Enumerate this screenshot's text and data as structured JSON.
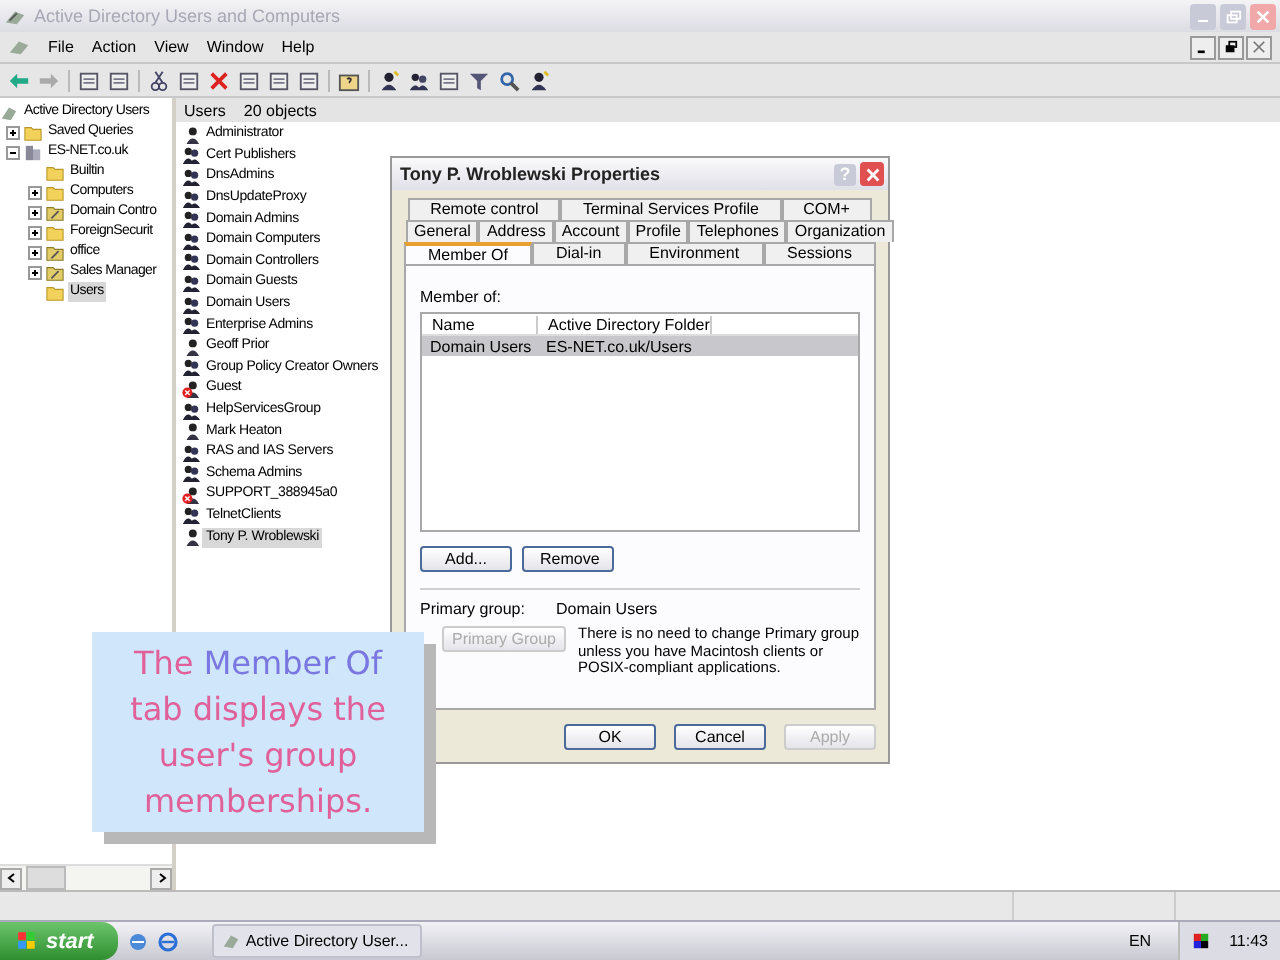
{
  "window": {
    "title": "Active Directory Users and Computers"
  },
  "menu": [
    "File",
    "Action",
    "View",
    "Window",
    "Help"
  ],
  "tree": {
    "label": "Active Directory Users",
    "children": [
      {
        "label": "Saved Queries",
        "kind": "folder",
        "expanded": false,
        "selected": false
      },
      {
        "label": "ES-NET.co.uk",
        "kind": "domain",
        "expanded": true,
        "selected": false,
        "children": [
          {
            "label": "Builtin",
            "kind": "folder",
            "selected": false
          },
          {
            "label": "Computers",
            "kind": "folder",
            "expanded": false,
            "selected": false
          },
          {
            "label": "Domain Contro",
            "kind": "ou",
            "expanded": false,
            "selected": false
          },
          {
            "label": "ForeignSecurit",
            "kind": "folder",
            "expanded": false,
            "selected": false
          },
          {
            "label": "office",
            "kind": "ou",
            "expanded": false,
            "selected": false
          },
          {
            "label": "Sales Manager",
            "kind": "ou",
            "expanded": false,
            "selected": false
          },
          {
            "label": "Users",
            "kind": "folder",
            "selected": true
          }
        ]
      }
    ]
  },
  "list": {
    "heading": "Users",
    "count": "20 objects",
    "items": [
      {
        "name": "Administrator",
        "kind": "user",
        "disabled": false,
        "selected": false
      },
      {
        "name": "Cert Publishers",
        "kind": "group",
        "disabled": false,
        "selected": false
      },
      {
        "name": "DnsAdmins",
        "kind": "group",
        "disabled": false,
        "selected": false
      },
      {
        "name": "DnsUpdateProxy",
        "kind": "group",
        "disabled": false,
        "selected": false
      },
      {
        "name": "Domain Admins",
        "kind": "group",
        "disabled": false,
        "selected": false
      },
      {
        "name": "Domain Computers",
        "kind": "group",
        "disabled": false,
        "selected": false
      },
      {
        "name": "Domain Controllers",
        "kind": "group",
        "disabled": false,
        "selected": false
      },
      {
        "name": "Domain Guests",
        "kind": "group",
        "disabled": false,
        "selected": false
      },
      {
        "name": "Domain Users",
        "kind": "group",
        "disabled": false,
        "selected": false
      },
      {
        "name": "Enterprise Admins",
        "kind": "group",
        "disabled": false,
        "selected": false
      },
      {
        "name": "Geoff Prior",
        "kind": "user",
        "disabled": false,
        "selected": false
      },
      {
        "name": "Group Policy Creator Owners",
        "kind": "group",
        "disabled": false,
        "selected": false
      },
      {
        "name": "Guest",
        "kind": "user",
        "disabled": true,
        "selected": false
      },
      {
        "name": "HelpServicesGroup",
        "kind": "group",
        "disabled": false,
        "selected": false
      },
      {
        "name": "Mark Heaton",
        "kind": "user",
        "disabled": false,
        "selected": false
      },
      {
        "name": "RAS and IAS Servers",
        "kind": "group",
        "disabled": false,
        "selected": false
      },
      {
        "name": "Schema Admins",
        "kind": "group",
        "disabled": false,
        "selected": false
      },
      {
        "name": "SUPPORT_388945a0",
        "kind": "user",
        "disabled": true,
        "selected": false
      },
      {
        "name": "TelnetClients",
        "kind": "group",
        "disabled": false,
        "selected": false
      },
      {
        "name": "Tony P. Wroblewski",
        "kind": "user",
        "disabled": false,
        "selected": true
      }
    ]
  },
  "dialog": {
    "title": "Tony P. Wroblewski Properties",
    "help_button": "?",
    "tab_rows": [
      [
        {
          "label": "Remote control",
          "selected": false
        },
        {
          "label": "Terminal Services Profile",
          "selected": false
        },
        {
          "label": "COM+",
          "selected": false
        }
      ],
      [
        {
          "label": "General",
          "selected": false
        },
        {
          "label": "Address",
          "selected": false
        },
        {
          "label": "Account",
          "selected": false
        },
        {
          "label": "Profile",
          "selected": false
        },
        {
          "label": "Telephones",
          "selected": false
        },
        {
          "label": "Organization",
          "selected": false
        }
      ],
      [
        {
          "label": "Member Of",
          "selected": true
        },
        {
          "label": "Dial-in",
          "selected": false
        },
        {
          "label": "Environment",
          "selected": false
        },
        {
          "label": "Sessions",
          "selected": false
        }
      ]
    ],
    "member_of_label": "Member of:",
    "columns": [
      "Name",
      "Active Directory Folder"
    ],
    "rows": [
      {
        "cells": [
          "Domain Users",
          "ES-NET.co.uk/Users"
        ],
        "selected": true
      }
    ],
    "add_button": "Add...",
    "remove_button": "Remove",
    "primary_group_label": "Primary group:",
    "primary_group_value": "Domain Users",
    "set_primary_button": {
      "label": "Primary Group",
      "disabled": true
    },
    "note": "There is no need to change Primary group unless you have Macintosh clients or POSIX-compliant applications.",
    "buttons": [
      {
        "label": "OK",
        "disabled": false
      },
      {
        "label": "Cancel",
        "disabled": false
      },
      {
        "label": "Apply",
        "disabled": true
      }
    ]
  },
  "callout": {
    "parts": [
      {
        "text": "The ",
        "emphasis": false
      },
      {
        "text": "Member Of",
        "emphasis": true
      },
      {
        "text": " tab displays the user's group memberships.",
        "emphasis": false
      }
    ]
  },
  "taskbar": {
    "start": "start",
    "task": "Active Directory User...",
    "language": "EN",
    "clock": "11:43"
  }
}
